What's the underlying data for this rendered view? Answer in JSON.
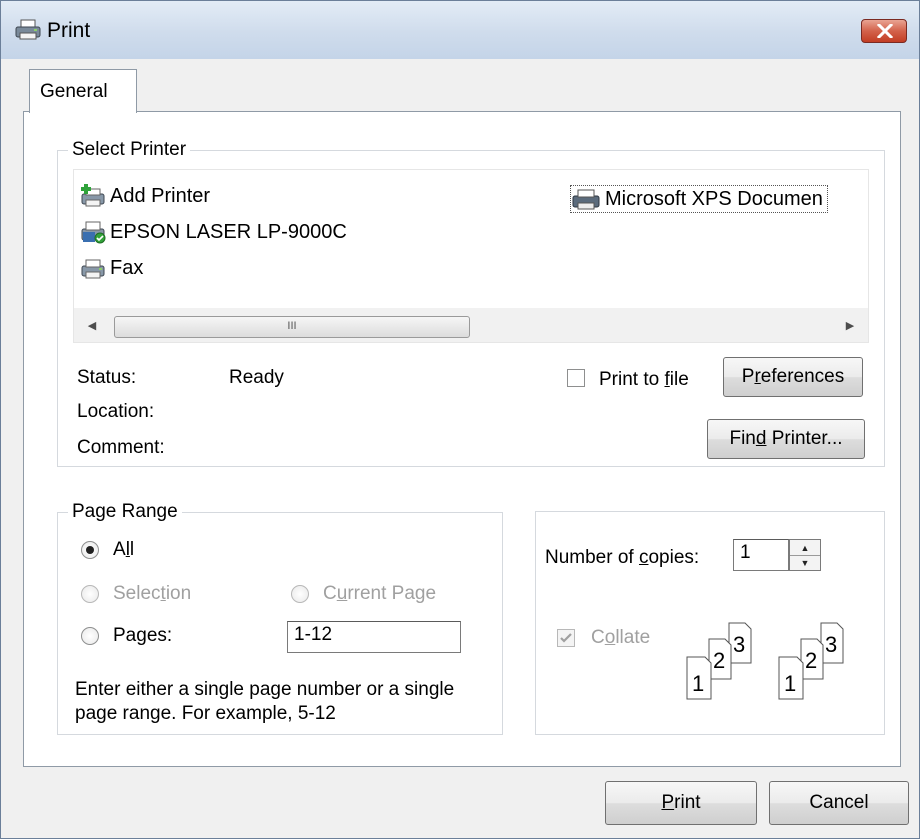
{
  "window": {
    "title": "Print"
  },
  "tabs": [
    {
      "label": "General"
    }
  ],
  "select_printer": {
    "legend": "Select Printer",
    "printers": [
      {
        "name": "Add Printer",
        "icon": "add-printer-icon"
      },
      {
        "name": "EPSON LASER LP-9000C",
        "icon": "default-printer-icon"
      },
      {
        "name": "Fax",
        "icon": "fax-printer-icon"
      },
      {
        "name": "Microsoft XPS Documen",
        "icon": "xps-printer-icon",
        "selected": true
      }
    ],
    "scrollbar_grip": "III",
    "status_label": "Status:",
    "status_value": "Ready",
    "location_label": "Location:",
    "comment_label": "Comment:",
    "print_to_file": {
      "pre": "Print to ",
      "acc": "f",
      "post": "ile",
      "checked": false
    },
    "preferences": {
      "pre": "P",
      "acc": "r",
      "post": "eferences"
    },
    "find_printer": {
      "pre": "Fin",
      "acc": "d",
      "post": " Printer..."
    }
  },
  "page_range": {
    "legend": "Page Range",
    "all": {
      "pre": "A",
      "acc": "l",
      "post": "l",
      "selected": true
    },
    "selection": {
      "pre": "Selec",
      "acc": "t",
      "post": "ion",
      "enabled": false
    },
    "current_page": {
      "pre": "C",
      "acc": "u",
      "post": "rrent Page",
      "enabled": false
    },
    "pages": {
      "pre": "Pa",
      "acc": "g",
      "post": "es:",
      "value": "1-12"
    },
    "hint_line1": "Enter either a single page number or a single",
    "hint_line2": "page range.  For example, 5-12"
  },
  "copies": {
    "label_pre": "Number of ",
    "label_acc": "c",
    "label_post": "opies:",
    "value": "1",
    "collate": {
      "pre": "C",
      "acc": "o",
      "post": "llate",
      "checked": true,
      "enabled": false
    },
    "collate_pages": [
      "1",
      "2",
      "3"
    ]
  },
  "footer": {
    "print": {
      "pre": "",
      "acc": "P",
      "post": "rint"
    },
    "cancel": "Cancel"
  },
  "colors": {
    "dialog_bg": "#f0f0f0",
    "titlebar": "#cfdcec",
    "close_button": "#c23d24",
    "disabled_text": "#a0a0a0"
  }
}
